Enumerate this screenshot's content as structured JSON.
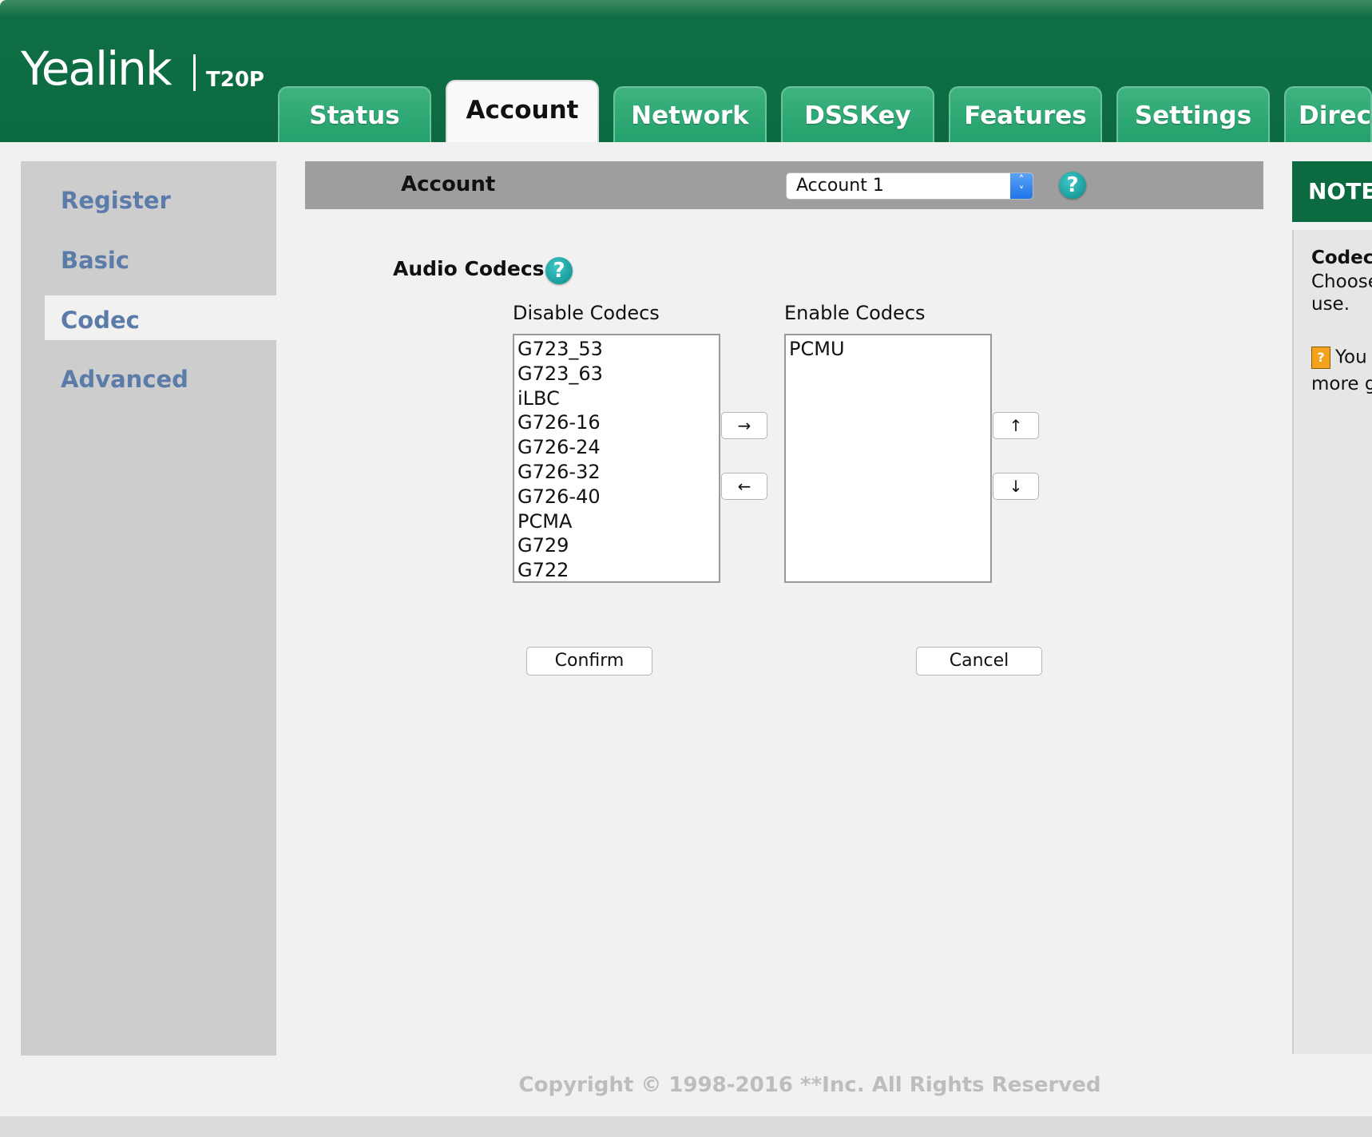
{
  "header": {
    "logo_text": "Yealink",
    "model": "T20P"
  },
  "tabs": [
    {
      "label": "Status",
      "active": false
    },
    {
      "label": "Account",
      "active": true
    },
    {
      "label": "Network",
      "active": false
    },
    {
      "label": "DSSKey",
      "active": false
    },
    {
      "label": "Features",
      "active": false
    },
    {
      "label": "Settings",
      "active": false
    },
    {
      "label": "Directory",
      "active": false
    }
  ],
  "sidebar": {
    "items": [
      {
        "label": "Register"
      },
      {
        "label": "Basic"
      },
      {
        "label": "Codec",
        "active": true
      },
      {
        "label": "Advanced"
      }
    ]
  },
  "account_bar": {
    "label": "Account",
    "selected": "Account 1"
  },
  "codecs": {
    "section_title": "Audio Codecs",
    "disable_label": "Disable Codecs",
    "enable_label": "Enable Codecs",
    "disabled": [
      "G723_53",
      "G723_63",
      "iLBC",
      "G726-16",
      "G726-24",
      "G726-32",
      "G726-40",
      "PCMA",
      "G729",
      "G722"
    ],
    "enabled": [
      "PCMU"
    ],
    "move_right": "→",
    "move_left": "←",
    "move_up": "↑",
    "move_down": "↓"
  },
  "actions": {
    "confirm": "Confirm",
    "cancel": "Cancel"
  },
  "note": {
    "title": "NOTE",
    "heading": "Codecs",
    "line1": "Choose",
    "line2": "use.",
    "line3": "You",
    "line4": "more g"
  },
  "footer": {
    "copyright": "Copyright © 1998-2016 **Inc. All Rights Reserved"
  },
  "colors": {
    "brand_green": "#0b6a40",
    "tab_green": "#23a06b",
    "link_blue": "#5b7ca8",
    "help_teal": "#0a8c8c"
  }
}
